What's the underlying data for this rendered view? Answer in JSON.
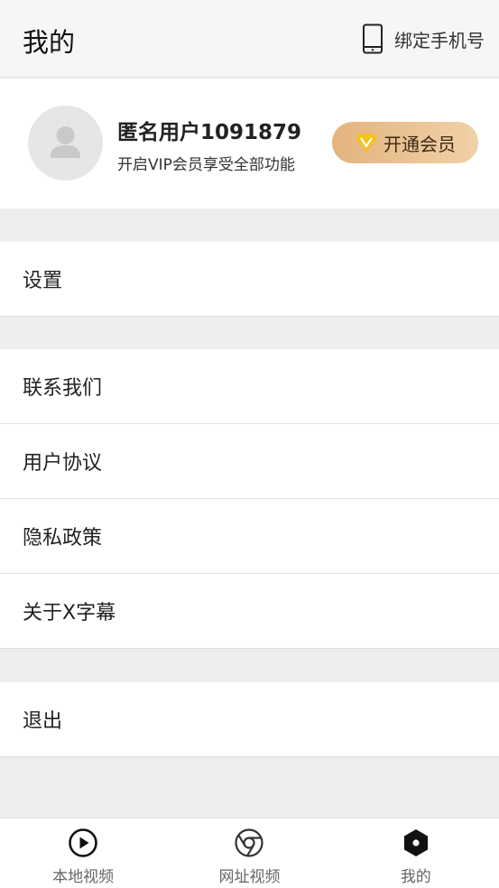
{
  "header": {
    "title": "我的",
    "bind_phone_label": "绑定手机号",
    "bind_phone_icon": "phone-icon"
  },
  "profile": {
    "avatar_icon": "user-avatar-icon",
    "username": "匿名用户1091879",
    "subtitle": "开启VIP会员享受全部功能",
    "vip_button_label": "开通会员",
    "vip_icon": "diamond-v-icon"
  },
  "menu": {
    "settings": "设置",
    "contact": "联系我们",
    "agreement": "用户协议",
    "privacy": "隐私政策",
    "about": "关于X字幕",
    "logout": "退出"
  },
  "tabbar": {
    "tabs": [
      {
        "label": "本地视频",
        "icon": "play-circle-icon"
      },
      {
        "label": "网址视频",
        "icon": "browser-icon"
      },
      {
        "label": "我的",
        "icon": "hexagon-dot-icon"
      }
    ]
  },
  "colors": {
    "background": "#eeeeee",
    "vip_gradient_start": "#e3b47e",
    "vip_gradient_end": "#f1d1a8",
    "vip_diamond": "#f5c21b"
  }
}
